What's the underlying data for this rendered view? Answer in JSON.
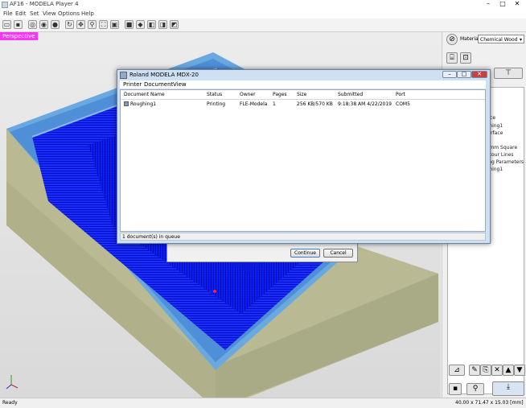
{
  "window": {
    "title": "AF16 - MODELA Player 4"
  },
  "menu": [
    "File",
    "Edit",
    "Set",
    "View",
    "Options",
    "Help"
  ],
  "viewport": {
    "label": "Perspective"
  },
  "material": {
    "label": "Material",
    "value": "Chemical Wood"
  },
  "tree_items": [
    "urface",
    "oughing1",
    "y Surface",
    "",
    "175mm Square",
    "Contour Lines",
    "utting Parameters",
    "oughing1"
  ],
  "statusbar": {
    "left": "Ready",
    "right": "40.00 x 71.47 x 15.03 [mm]"
  },
  "print_dialog": {
    "title": "Roland MODELA MDX-20",
    "menu": [
      "Printer",
      "Document",
      "View"
    ],
    "columns": [
      "Document Name",
      "Status",
      "Owner",
      "Pages",
      "Size",
      "Submitted",
      "Port"
    ],
    "rows": [
      {
        "name": "Roughing1",
        "status": "Printing",
        "owner": "FLE-Modela",
        "pages": "1",
        "size": "256 KB/570 KB",
        "submitted": "9:18:38 AM 4/22/2019",
        "port": "COM5"
      }
    ],
    "status": "1 document(s) in queue"
  },
  "under_dialog": {
    "continue_label": "Continue",
    "cancel_label": "Cancel"
  },
  "colors": {
    "toolpath": "#0a1ef0",
    "stock_top": "#6aa8e0",
    "stock_side": "#b8b890",
    "perspective_tag": "#ff33ff"
  }
}
